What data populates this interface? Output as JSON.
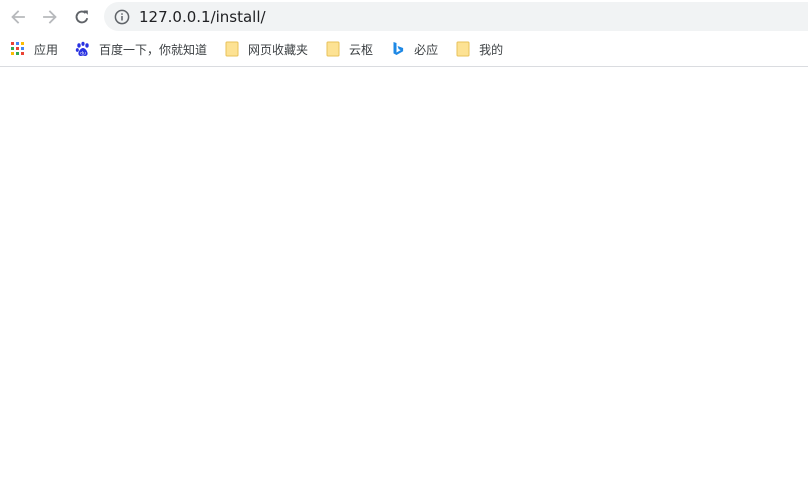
{
  "toolbar": {
    "url": "127.0.0.1/install/"
  },
  "bookmarks": [
    {
      "label": "应用",
      "icon": "apps-grid-icon"
    },
    {
      "label": "百度一下，你就知道",
      "icon": "baidu-paw-icon"
    },
    {
      "label": "网页收藏夹",
      "icon": "folder-icon"
    },
    {
      "label": "云枢",
      "icon": "folder-icon"
    },
    {
      "label": "必应",
      "icon": "bing-icon"
    },
    {
      "label": "我的",
      "icon": "folder-icon"
    }
  ],
  "colors": {
    "omnibox_bg": "#f1f3f4",
    "folder": "#f9d978",
    "bing": "#1e88e5",
    "baidu": "#2932e1"
  }
}
